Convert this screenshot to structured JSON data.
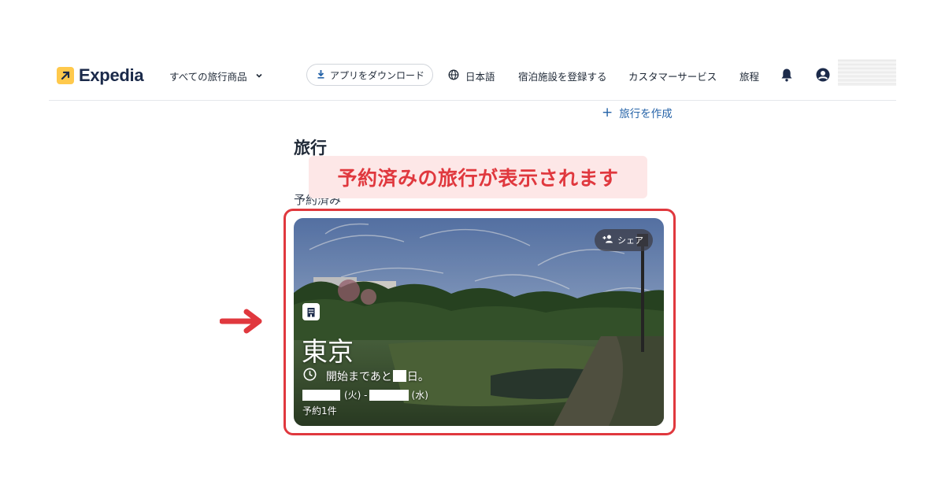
{
  "header": {
    "logo_text": "Expedia",
    "all_products": "すべての旅行商品",
    "download_app": "アプリをダウンロード",
    "language": "日本語",
    "register_property": "宿泊施設を登録する",
    "customer_service": "カスタマーサービス",
    "trips": "旅程",
    "icons": [
      "expedia-logo-icon",
      "chevron-down-icon",
      "download-icon",
      "globe-icon",
      "bell-icon",
      "account-icon"
    ]
  },
  "main": {
    "create_trip": "旅行を作成",
    "page_title": "旅行",
    "section_label": "予約済み"
  },
  "annotation": {
    "callout_text": "予約済みの旅行が表示されます",
    "color": "#e0383e"
  },
  "trip_card": {
    "share_label": "シェア",
    "city": "東京",
    "countdown_prefix": "開始まであと",
    "countdown_suffix": "日。",
    "start_weekday": "(火) -",
    "end_weekday": "(水)",
    "bookings": "予約1件",
    "icons": [
      "hotel-icon",
      "clock-icon",
      "person-add-icon"
    ]
  },
  "colors": {
    "brand_yellow": "#ffc94c",
    "brand_navy": "#1b2a4a",
    "link_blue": "#2563a8",
    "highlight_red": "#e0383e"
  }
}
